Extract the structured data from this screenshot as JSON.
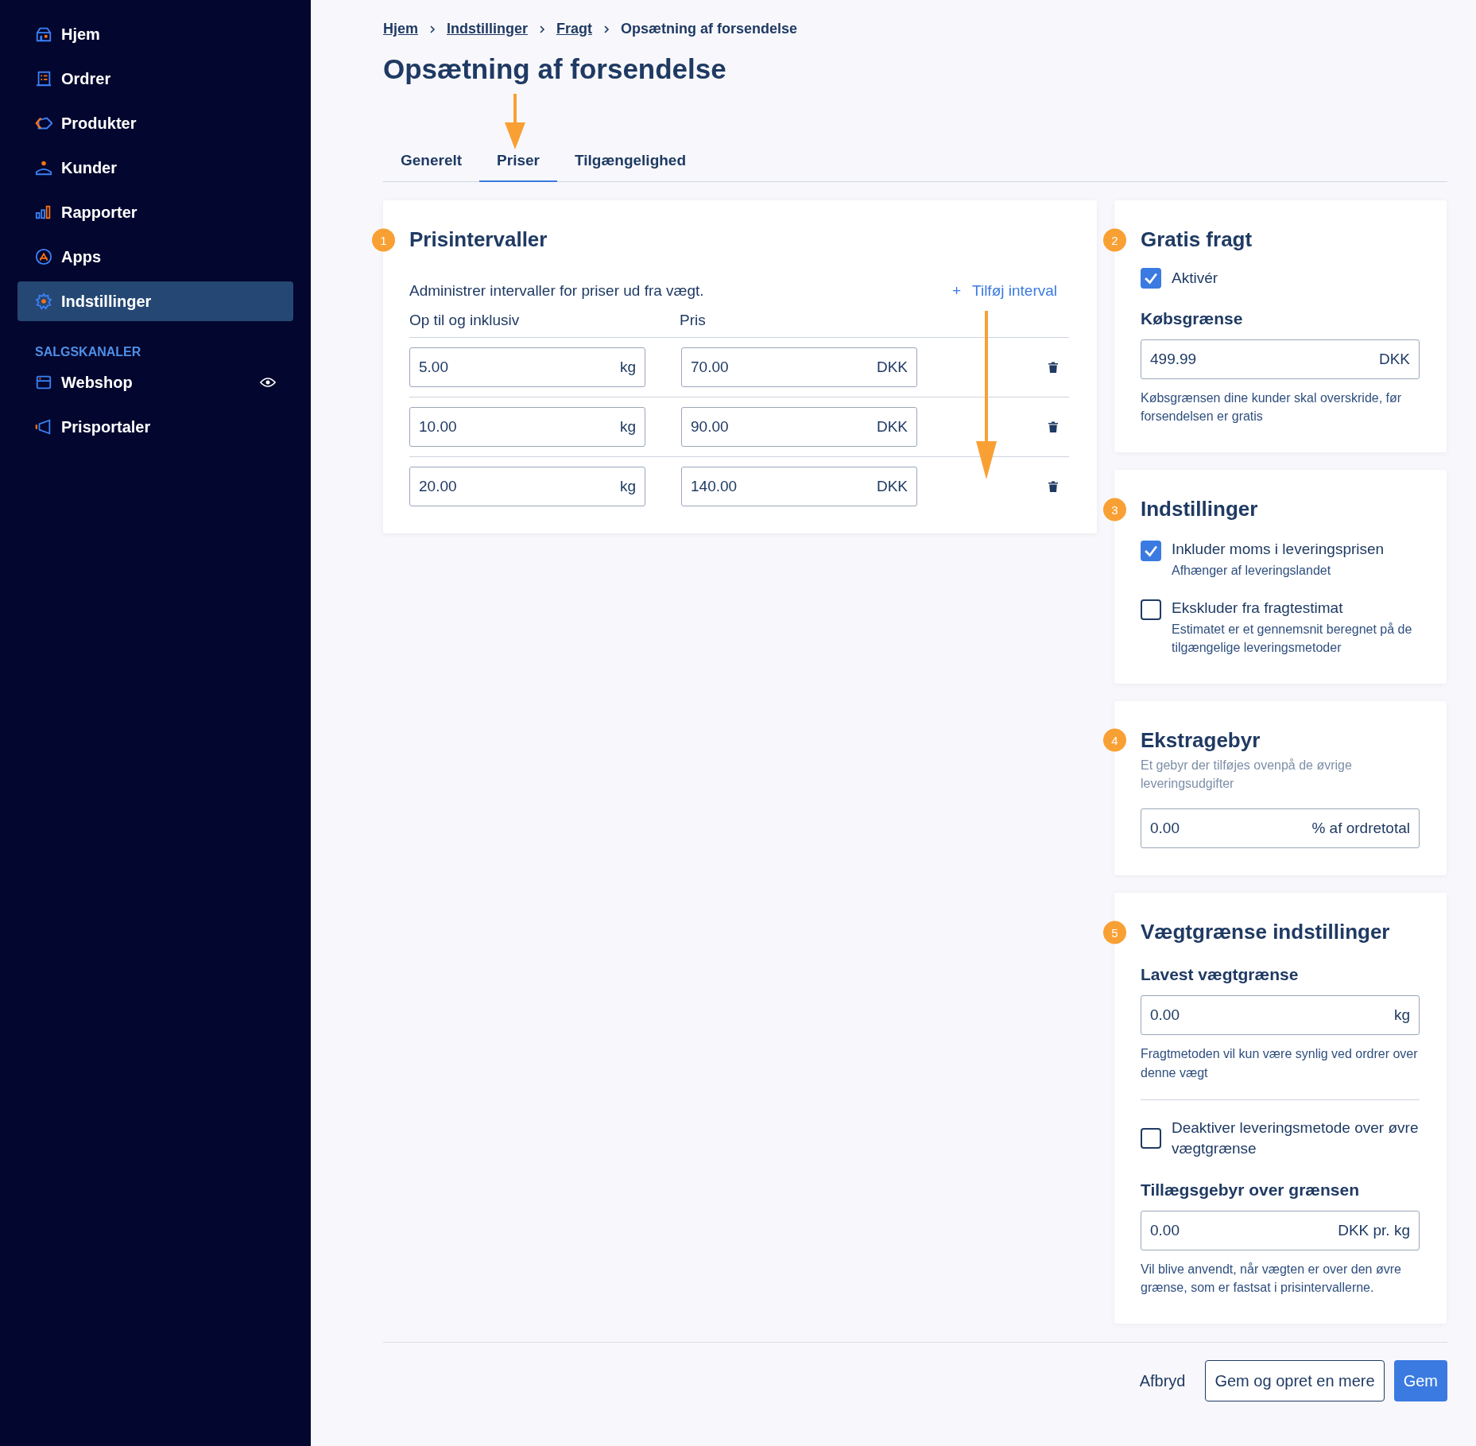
{
  "sidebar": {
    "items": [
      {
        "label": "Hjem",
        "selected": false
      },
      {
        "label": "Ordrer",
        "selected": false
      },
      {
        "label": "Produkter",
        "selected": false
      },
      {
        "label": "Kunder",
        "selected": false
      },
      {
        "label": "Rapporter",
        "selected": false
      },
      {
        "label": "Apps",
        "selected": false
      },
      {
        "label": "Indstillinger",
        "selected": true
      }
    ],
    "section_title": "SALGSKANALER",
    "channels": [
      {
        "label": "Webshop",
        "visible": true
      },
      {
        "label": "Prisportaler",
        "visible": false
      }
    ]
  },
  "breadcrumb": [
    {
      "label": "Hjem",
      "link": true
    },
    {
      "label": "Indstillinger",
      "link": true
    },
    {
      "label": "Fragt",
      "link": true
    },
    {
      "label": "Opsætning af forsendelse",
      "link": false
    }
  ],
  "title": "Opsætning af forsendelse",
  "tabs": [
    {
      "label": "Generelt",
      "selected": false
    },
    {
      "label": "Priser",
      "selected": true
    },
    {
      "label": "Tilgængelighed",
      "selected": false
    }
  ],
  "price_intervals": {
    "step": "1",
    "title": "Prisintervaller",
    "description": "Administrer intervaller for priser ud fra vægt.",
    "add_button": "+",
    "add_label": "Tilføj interval",
    "columns": [
      "Op til og inklusiv",
      "Pris"
    ],
    "rows": [
      {
        "weight": "5.00",
        "weight_unit": "kg",
        "price": "70.00",
        "currency": "DKK"
      },
      {
        "weight": "10.00",
        "weight_unit": "kg",
        "price": "90.00",
        "currency": "DKK"
      },
      {
        "weight": "20.00",
        "weight_unit": "kg",
        "price": "140.00",
        "currency": "DKK"
      }
    ]
  },
  "free_shipping": {
    "step": "2",
    "title": "Gratis fragt",
    "checkbox": {
      "label": "Aktivér",
      "checked": true
    },
    "field_label": "Købsgrænse",
    "field": {
      "value": "499.99",
      "unit": "DKK"
    },
    "help": "Købsgrænsen dine kunder skal overskride, før forsendelsen er gratis"
  },
  "settings": {
    "step": "3",
    "title": "Indstillinger",
    "options": [
      {
        "label": "Inkluder moms i leveringsprisen",
        "hint": "Afhænger af leveringslandet",
        "checked": true
      },
      {
        "label": "Ekskluder fra fragtestimat",
        "hint": "Estimatet er et gennemsnit beregnet på de tilgængelige leveringsmetoder",
        "checked": false
      }
    ]
  },
  "extra_fee": {
    "step": "4",
    "title": "Ekstragebyr",
    "subtitle": "Et gebyr der tilføjes ovenpå de øvrige leveringsudgifter",
    "field": {
      "value": "0.00",
      "unit": "% af ordretotal"
    }
  },
  "weight_limits": {
    "step": "5",
    "title": "Vægtgrænse indstillinger",
    "min_label": "Lavest vægtgrænse",
    "min_field": {
      "value": "0.00",
      "unit": "kg"
    },
    "min_help": "Fragtmetoden vil kun være synlig ved ordrer over denne vægt",
    "option": {
      "label": "Deaktiver leveringsmetode over øvre vægtgrænse",
      "checked": false
    },
    "surcharge_label": "Tillægsgebyr over grænsen",
    "surcharge_field": {
      "value": "0.00",
      "unit": "DKK pr. kg"
    },
    "surcharge_help": "Vil blive anvendt, når vægten er over den øvre grænse, som er fastsat i prisintervallerne."
  },
  "footer_buttons": [
    {
      "label": "Afbryd",
      "kind": "link"
    },
    {
      "label": "Gem og opret en mere",
      "kind": "outline"
    },
    {
      "label": "Gem",
      "kind": "primary"
    }
  ]
}
